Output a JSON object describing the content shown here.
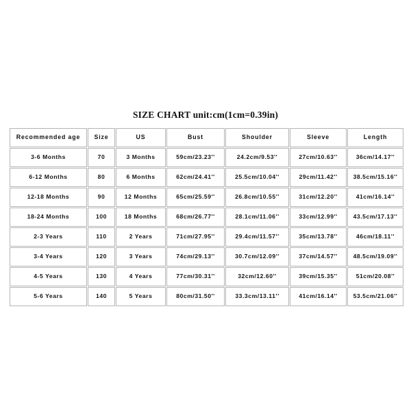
{
  "title": "SIZE CHART unit:cm(1cm=0.39in)",
  "chart_data": {
    "type": "table",
    "title": "SIZE CHART unit:cm(1cm=0.39in)",
    "columns": [
      "Recommended age",
      "Size",
      "US",
      "Bust",
      "Shoulder",
      "Sleeve",
      "Length"
    ],
    "rows": [
      [
        "3-6 Months",
        "70",
        "3 Months",
        "59cm/23.23''",
        "24.2cm/9.53''",
        "27cm/10.63''",
        "36cm/14.17''"
      ],
      [
        "6-12 Months",
        "80",
        "6 Months",
        "62cm/24.41''",
        "25.5cm/10.04''",
        "29cm/11.42''",
        "38.5cm/15.16''"
      ],
      [
        "12-18 Months",
        "90",
        "12 Months",
        "65cm/25.59''",
        "26.8cm/10.55''",
        "31cm/12.20''",
        "41cm/16.14''"
      ],
      [
        "18-24 Months",
        "100",
        "18 Months",
        "68cm/26.77''",
        "28.1cm/11.06''",
        "33cm/12.99''",
        "43.5cm/17.13''"
      ],
      [
        "2-3 Years",
        "110",
        "2 Years",
        "71cm/27.95''",
        "29.4cm/11.57''",
        "35cm/13.78''",
        "46cm/18.11''"
      ],
      [
        "3-4 Years",
        "120",
        "3 Years",
        "74cm/29.13''",
        "30.7cm/12.09''",
        "37cm/14.57''",
        "48.5cm/19.09''"
      ],
      [
        "4-5 Years",
        "130",
        "4 Years",
        "77cm/30.31''",
        "32cm/12.60''",
        "39cm/15.35''",
        "51cm/20.08''"
      ],
      [
        "5-6 Years",
        "140",
        "5 Years",
        "80cm/31.50''",
        "33.3cm/13.11''",
        "41cm/16.14''",
        "53.5cm/21.06''"
      ]
    ]
  }
}
